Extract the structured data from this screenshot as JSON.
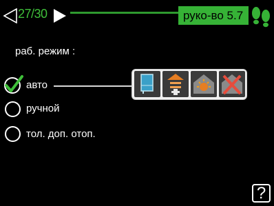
{
  "header": {
    "page_indicator": "27/30",
    "menu_title": "руко-во 5.7"
  },
  "section_label": "раб. режим :",
  "options": [
    {
      "label": "авто",
      "selected": true
    },
    {
      "label": "ручной",
      "selected": false
    },
    {
      "label": "тол. доп. отоп.",
      "selected": false
    }
  ],
  "mode_icons": [
    "compressor-icon",
    "additional-heat-icon",
    "heating-icon",
    "disabled-icon"
  ],
  "help": {
    "label": "?"
  },
  "colors": {
    "accent_green": "#36b236",
    "background": "#000000"
  }
}
